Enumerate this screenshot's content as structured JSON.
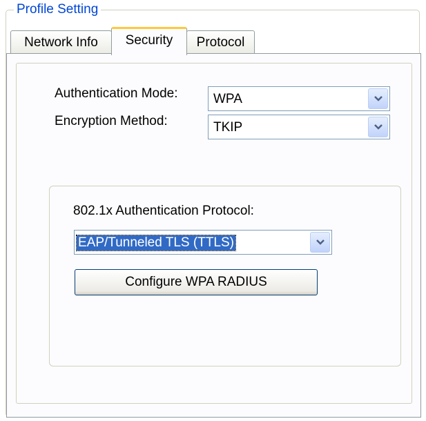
{
  "profile": {
    "title": "Profile Setting"
  },
  "tabs": [
    {
      "label": "Network Info"
    },
    {
      "label": "Security"
    },
    {
      "label": "Protocol"
    }
  ],
  "security": {
    "auth_mode_label": "Authentication Mode:",
    "auth_mode_value": "WPA",
    "encryption_label": "Encryption Method:",
    "encryption_value": "TKIP",
    "protocol_label": "802.1x Authentication Protocol:",
    "protocol_value": "EAP/Tunneled TLS (TTLS)",
    "configure_button": "Configure WPA RADIUS"
  },
  "colors": {
    "accent_title": "#0046d5",
    "selected_tab_highlight": "#ffc83c",
    "selection_bg": "#316ac5"
  },
  "icons": {
    "dropdown": "chevron-down-icon"
  }
}
